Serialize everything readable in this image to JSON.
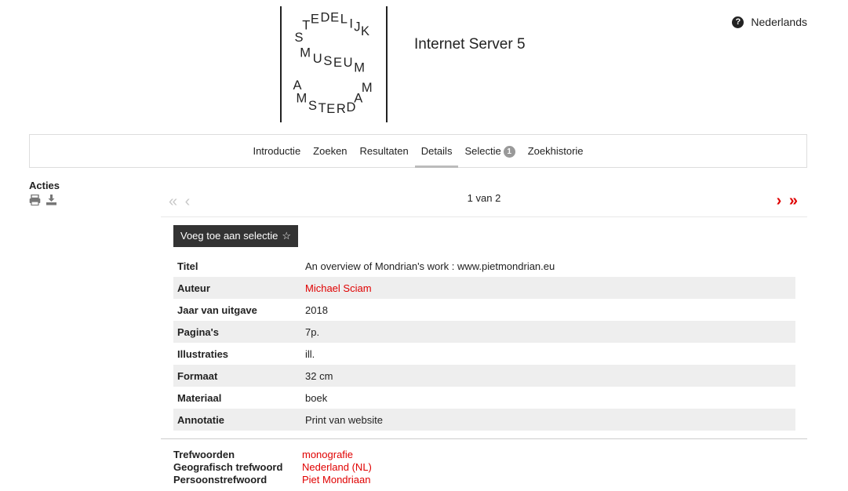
{
  "logo": {
    "line1": "STEDELIJK",
    "line2": "MUSEUM",
    "line3": "AMSTERDAM"
  },
  "header": {
    "server_title": "Internet Server 5",
    "language_label": "Nederlands"
  },
  "nav": {
    "items": [
      {
        "label": "Introductie"
      },
      {
        "label": "Zoeken"
      },
      {
        "label": "Resultaten"
      },
      {
        "label": "Details",
        "active": true
      },
      {
        "label": "Selectie",
        "badge": "1"
      },
      {
        "label": "Zoekhistorie"
      }
    ]
  },
  "sidebar": {
    "title": "Acties",
    "icons": [
      "print-icon",
      "download-icon"
    ]
  },
  "pager": {
    "first_prev": "« ‹",
    "count_text": "1 van 2",
    "next_last": "› »"
  },
  "actions": {
    "add_to_selection": "Voeg toe aan selectie",
    "star_icon": "☆"
  },
  "details": {
    "rows": [
      {
        "label": "Titel",
        "value": "An overview of Mondrian's work : www.pietmondrian.eu",
        "link": false
      },
      {
        "label": "Auteur",
        "value": "Michael Sciam",
        "link": true
      },
      {
        "label": "Jaar van uitgave",
        "value": "2018",
        "link": false
      },
      {
        "label": "Pagina's",
        "value": "7p.",
        "link": false
      },
      {
        "label": "Illustraties",
        "value": "ill.",
        "link": false
      },
      {
        "label": "Formaat",
        "value": "32 cm",
        "link": false
      },
      {
        "label": "Materiaal",
        "value": "boek",
        "link": false
      },
      {
        "label": "Annotatie",
        "value": "Print van website",
        "link": false
      }
    ]
  },
  "keywords": {
    "rows": [
      {
        "label": "Trefwoorden",
        "value": "monografie"
      },
      {
        "label": "Geografisch trefwoord",
        "value": "Nederland (NL)"
      },
      {
        "label": "Persoonstrefwoord",
        "value": "Piet Mondriaan"
      }
    ]
  },
  "colors": {
    "link_red": "#e00000",
    "pager_disabled": "#c8c8c8",
    "button_dark": "#333333",
    "row_stripe": "#eeeeee"
  }
}
